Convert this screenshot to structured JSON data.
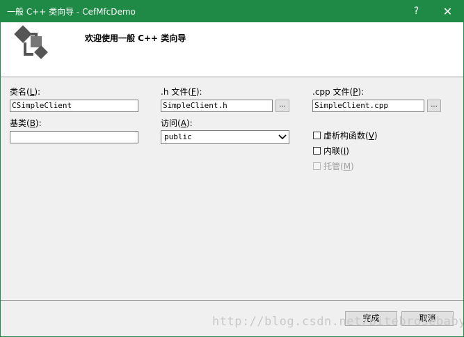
{
  "window": {
    "title": "一般 C++ 类向导 - CefMfcDemo",
    "help_glyph": "?",
    "close_glyph": "✕"
  },
  "header": {
    "title": "欢迎使用一般 C++ 类向导"
  },
  "form": {
    "class_name": {
      "label_pre": "类名(",
      "key": "L",
      "label_post": "):",
      "value": "CSimpleClient"
    },
    "h_file": {
      "label_pre": ".h 文件(",
      "key": "F",
      "label_post": "):",
      "value": "SimpleClient.h",
      "browse_label": "..."
    },
    "cpp_file": {
      "label_pre": ".cpp 文件(",
      "key": "P",
      "label_post": "):",
      "value": "SimpleClient.cpp",
      "browse_label": "..."
    },
    "base_class": {
      "label_pre": "基类(",
      "key": "B",
      "label_post": "):",
      "value": ""
    },
    "access": {
      "label_pre": "访问(",
      "key": "A",
      "label_post": "):",
      "selected": "public"
    },
    "virtual_destructor": {
      "label_pre": "虚析构函数(",
      "key": "V",
      "label_post": ")",
      "checked": false
    },
    "inline": {
      "label_pre": "内联(",
      "key": "I",
      "label_post": ")",
      "checked": false
    },
    "managed": {
      "label_pre": "托管(",
      "key": "M",
      "label_post": ")",
      "checked": false,
      "disabled": true
    }
  },
  "buttons": {
    "finish": "完成",
    "cancel": "取消"
  },
  "watermark": "http://blog.csdn.net/bitebrosebaby"
}
